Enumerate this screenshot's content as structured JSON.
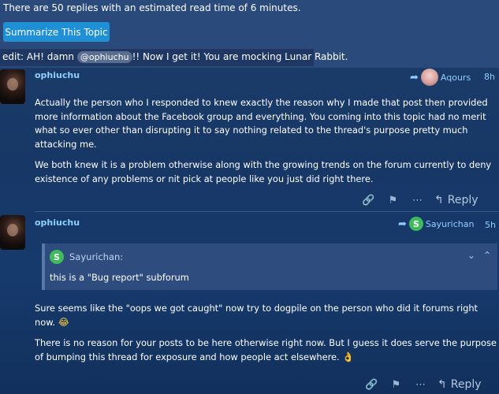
{
  "topic": {
    "summary_text": "There are 50 replies with an estimated read time of 6 minutes.",
    "summarize_button": "Summarize This Topic",
    "edit_prefix": "edit: AH! damn",
    "edit_mention": "@ophiuchu",
    "edit_suffix": "!! Now I get it! You are mocking Lunar Rabbit."
  },
  "posts": [
    {
      "username": "ophiuchu",
      "reply_to": "Aqours",
      "time": "8h",
      "paragraphs": [
        "Actually the person who I responded to knew exactly the reason why I made that post then provided more information about the Facebook group and everything. You coming into this topic had no merit what so ever other than disrupting it to say nothing related to the thread's purpose pretty much attacking me.",
        "We both knew it is a problem otherwise along with the growing trends on the forum currently to deny existence of any problems or nit pick at people like you just did right there."
      ],
      "reply_label": "Reply"
    },
    {
      "username": "ophiuchu",
      "reply_to": "Sayurichan",
      "reply_to_initial": "S",
      "time": "5h",
      "quote": {
        "author": "Sayurichan:",
        "author_initial": "S",
        "text": "this is a \"Bug report\" subforum"
      },
      "paragraphs": [
        "Sure seems like the \"oops we got caught\" now try to dogpile on the person who did it forums right now.",
        "There is no reason for your posts to be here otherwise right now. But I guess it does serve the purpose of bumping this thread for exposure and how people act elsewhere."
      ],
      "emojis": [
        "😂",
        "👌"
      ],
      "reply_label": "Reply"
    }
  ],
  "icons": {
    "reply_arrow": "reply-arrow-icon",
    "link": "link-icon",
    "bookmark": "bookmark-icon",
    "more": "ellipsis-icon",
    "chevron_down": "chevron-down-icon",
    "chevron_up": "chevron-up-icon"
  },
  "colors": {
    "accent": "#1f8fd6",
    "link": "#8fd0ff",
    "letter_avatar": "#3fbb5d"
  }
}
